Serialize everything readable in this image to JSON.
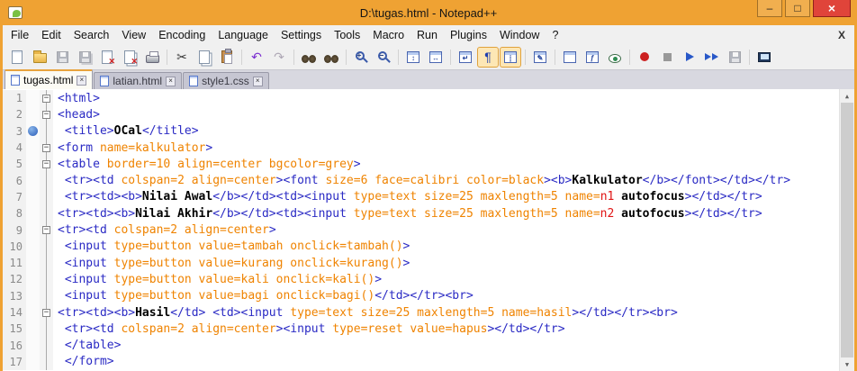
{
  "window": {
    "title": "D:\\tugas.html - Notepad++",
    "controls": {
      "minimize": "–",
      "maximize": "□",
      "close": "×"
    }
  },
  "menu": {
    "items": [
      "File",
      "Edit",
      "Search",
      "View",
      "Encoding",
      "Language",
      "Settings",
      "Tools",
      "Macro",
      "Run",
      "Plugins",
      "Window",
      "?"
    ],
    "close_label": "X"
  },
  "toolbar": {
    "items": [
      {
        "name": "new-file",
        "type": "page"
      },
      {
        "name": "open-file",
        "type": "folder"
      },
      {
        "name": "save",
        "type": "floppy",
        "disabled": true
      },
      {
        "name": "save-all",
        "type": "floppy2",
        "disabled": true
      },
      {
        "name": "close-file",
        "type": "pagex"
      },
      {
        "name": "close-all-files",
        "type": "pagex2"
      },
      {
        "name": "print",
        "type": "printer"
      },
      {
        "sep": true
      },
      {
        "name": "cut",
        "type": "glyph",
        "glyph": "✂",
        "color": "#3a3a3a"
      },
      {
        "name": "copy",
        "type": "copy"
      },
      {
        "name": "paste",
        "type": "paste"
      },
      {
        "sep": true
      },
      {
        "name": "undo",
        "type": "glyph",
        "glyph": "↶",
        "color": "#7b2fd0"
      },
      {
        "name": "redo",
        "type": "glyph",
        "glyph": "↷",
        "color": "#7b2fd0",
        "disabled": true
      },
      {
        "sep": true
      },
      {
        "name": "find",
        "type": "binoc"
      },
      {
        "name": "replace",
        "type": "binoc"
      },
      {
        "sep": true
      },
      {
        "name": "zoom-in",
        "type": "mag",
        "glyph": "+"
      },
      {
        "name": "zoom-out",
        "type": "mag",
        "glyph": "−"
      },
      {
        "sep": true
      },
      {
        "name": "sync-vertical-scroll",
        "type": "panel",
        "glyph": "↕"
      },
      {
        "name": "sync-horizontal-scroll",
        "type": "panel",
        "glyph": "↔"
      },
      {
        "sep": true
      },
      {
        "name": "word-wrap",
        "type": "panel",
        "glyph": "↵"
      },
      {
        "name": "show-all-characters",
        "type": "glyph",
        "glyph": "¶",
        "color": "#1f3fae",
        "active": true
      },
      {
        "name": "show-indent-guide",
        "type": "panel",
        "glyph": "┆",
        "active": true
      },
      {
        "sep": true
      },
      {
        "name": "user-defined-dialog",
        "type": "panel",
        "glyph": "✎"
      },
      {
        "sep": true
      },
      {
        "name": "doc-map",
        "type": "panel",
        "glyph": ""
      },
      {
        "name": "function-list",
        "type": "panel",
        "glyph": "ƒ"
      },
      {
        "name": "monitoring-eye",
        "type": "eye"
      },
      {
        "sep": true
      },
      {
        "name": "macro-record",
        "type": "circle",
        "color": "#cc2020"
      },
      {
        "name": "macro-stop",
        "type": "square",
        "color": "#222222",
        "disabled": true
      },
      {
        "name": "macro-play",
        "type": "tri"
      },
      {
        "name": "macro-run-multiple",
        "type": "tri2"
      },
      {
        "name": "macro-save",
        "type": "floppy",
        "disabled": true
      },
      {
        "sep": true
      },
      {
        "name": "doc-switcher",
        "type": "monitor"
      }
    ]
  },
  "tabs": {
    "close_glyph": "×",
    "items": [
      {
        "label": "tugas.html",
        "active": true
      },
      {
        "label": "latian.html",
        "active": false
      },
      {
        "label": "style1.css",
        "active": false
      }
    ]
  },
  "editor": {
    "fold_minus": "−",
    "scrollbar": {
      "up": "▲",
      "down": "▼"
    },
    "lines": [
      {
        "n": 1,
        "f": "m",
        "t": [
          {
            "s": "t",
            "x": "<html>"
          }
        ]
      },
      {
        "n": 2,
        "f": "m",
        "t": [
          {
            "s": "t",
            "x": "<head>"
          }
        ]
      },
      {
        "n": 3,
        "f": "l",
        "b": true,
        "t": [
          {
            "s": "p",
            "x": " "
          },
          {
            "s": "t",
            "x": "<title>"
          },
          {
            "s": "k",
            "x": "OCal"
          },
          {
            "s": "t",
            "x": "</title>"
          }
        ]
      },
      {
        "n": 4,
        "f": "m",
        "t": [
          {
            "s": "t",
            "x": "<form "
          },
          {
            "s": "a",
            "x": "name=kalkulator"
          },
          {
            "s": "t",
            "x": ">"
          }
        ]
      },
      {
        "n": 5,
        "f": "m",
        "t": [
          {
            "s": "t",
            "x": "<table "
          },
          {
            "s": "a",
            "x": "border=10 align=center bgcolor=grey"
          },
          {
            "s": "t",
            "x": ">"
          }
        ]
      },
      {
        "n": 6,
        "f": "l",
        "t": [
          {
            "s": "p",
            "x": " "
          },
          {
            "s": "t",
            "x": "<tr><td "
          },
          {
            "s": "a",
            "x": "colspan=2 align=center"
          },
          {
            "s": "t",
            "x": "><font "
          },
          {
            "s": "a",
            "x": "size=6 face=calibri color=black"
          },
          {
            "s": "t",
            "x": "><b>"
          },
          {
            "s": "k",
            "x": "Kalkulator"
          },
          {
            "s": "t",
            "x": "</b></font></td></tr>"
          }
        ]
      },
      {
        "n": 7,
        "f": "l",
        "t": [
          {
            "s": "p",
            "x": " "
          },
          {
            "s": "t",
            "x": "<tr><td><b>"
          },
          {
            "s": "k",
            "x": "Nilai Awal"
          },
          {
            "s": "t",
            "x": "</b></td><td><input "
          },
          {
            "s": "a",
            "x": "type=text size=25 maxlength=5 name="
          },
          {
            "s": "r",
            "x": "n1"
          },
          {
            "s": "k",
            "x": " autofocus"
          },
          {
            "s": "t",
            "x": "></td></tr>"
          }
        ]
      },
      {
        "n": 8,
        "f": "l",
        "t": [
          {
            "s": "t",
            "x": "<tr><td><b>"
          },
          {
            "s": "k",
            "x": "Nilai Akhir"
          },
          {
            "s": "t",
            "x": "</b></td><td><input "
          },
          {
            "s": "a",
            "x": "type=text size=25 maxlength=5 name="
          },
          {
            "s": "r",
            "x": "n2"
          },
          {
            "s": "k",
            "x": " autofocus"
          },
          {
            "s": "t",
            "x": "></td></tr>"
          }
        ]
      },
      {
        "n": 9,
        "f": "m",
        "t": [
          {
            "s": "t",
            "x": "<tr><td "
          },
          {
            "s": "a",
            "x": "colspan=2 align=center"
          },
          {
            "s": "t",
            "x": ">"
          }
        ]
      },
      {
        "n": 10,
        "f": "l",
        "t": [
          {
            "s": "p",
            "x": " "
          },
          {
            "s": "t",
            "x": "<input "
          },
          {
            "s": "a",
            "x": "type=button value=tambah onclick=tambah()"
          },
          {
            "s": "t",
            "x": ">"
          }
        ]
      },
      {
        "n": 11,
        "f": "l",
        "t": [
          {
            "s": "p",
            "x": " "
          },
          {
            "s": "t",
            "x": "<input "
          },
          {
            "s": "a",
            "x": "type=button value=kurang onclick=kurang()"
          },
          {
            "s": "t",
            "x": ">"
          }
        ]
      },
      {
        "n": 12,
        "f": "l",
        "t": [
          {
            "s": "p",
            "x": " "
          },
          {
            "s": "t",
            "x": "<input "
          },
          {
            "s": "a",
            "x": "type=button value=kali onclick=kali()"
          },
          {
            "s": "t",
            "x": ">"
          }
        ]
      },
      {
        "n": 13,
        "f": "l",
        "t": [
          {
            "s": "p",
            "x": " "
          },
          {
            "s": "t",
            "x": "<input "
          },
          {
            "s": "a",
            "x": "type=button value=bagi onclick=bagi()"
          },
          {
            "s": "t",
            "x": "</td></tr><br>"
          }
        ]
      },
      {
        "n": 14,
        "f": "m",
        "t": [
          {
            "s": "t",
            "x": "<tr><td><b>"
          },
          {
            "s": "k",
            "x": "Hasil"
          },
          {
            "s": "t",
            "x": "</td> <td><input "
          },
          {
            "s": "a",
            "x": "type=text size=25 maxlength=5 name=hasil"
          },
          {
            "s": "t",
            "x": "></td></tr><br>"
          }
        ]
      },
      {
        "n": 15,
        "f": "l",
        "t": [
          {
            "s": "p",
            "x": " "
          },
          {
            "s": "t",
            "x": "<tr><td "
          },
          {
            "s": "a",
            "x": "colspan=2 align=center"
          },
          {
            "s": "t",
            "x": "><input "
          },
          {
            "s": "a",
            "x": "type=reset value=hapus"
          },
          {
            "s": "t",
            "x": "></td></tr>"
          }
        ]
      },
      {
        "n": 16,
        "f": "l",
        "t": [
          {
            "s": "p",
            "x": " "
          },
          {
            "s": "t",
            "x": "</table>"
          }
        ]
      },
      {
        "n": 17,
        "f": "l",
        "t": [
          {
            "s": "p",
            "x": " "
          },
          {
            "s": "t",
            "x": "</form>"
          }
        ]
      }
    ]
  },
  "colors": {
    "titlebar": "#efa233",
    "close_button": "#e0443a",
    "tag": "#2a2ac4",
    "attribute": "#ef8300",
    "value_red": "#e01414",
    "text_content": "#000000",
    "line_number": "#8a8a8a",
    "bookmark": "#2a5cb8",
    "toolbar_active_bg": "#fde7b5"
  }
}
